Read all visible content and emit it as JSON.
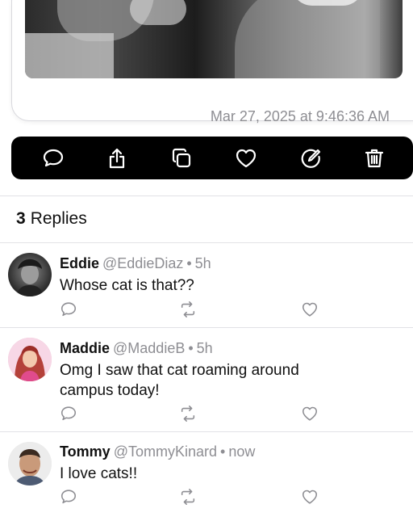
{
  "post": {
    "timestamp": "Mar 27, 2025 at 9:46:36 AM"
  },
  "actions": [
    {
      "name": "comment",
      "icon": "speech-bubble-icon"
    },
    {
      "name": "share",
      "icon": "share-icon"
    },
    {
      "name": "repost",
      "icon": "copy-icon"
    },
    {
      "name": "like",
      "icon": "heart-icon"
    },
    {
      "name": "edit",
      "icon": "edit-icon"
    },
    {
      "name": "delete",
      "icon": "trash-icon"
    }
  ],
  "replies_header": {
    "count": "3",
    "label": "Replies"
  },
  "replies": [
    {
      "name": "Eddie",
      "handle": "@EddieDiaz",
      "separator": "•",
      "time": "5h",
      "text": "Whose cat is that??"
    },
    {
      "name": "Maddie",
      "handle": "@MaddieB",
      "separator": "•",
      "time": "5h",
      "text": "Omg I saw that cat roaming around campus today!"
    },
    {
      "name": "Tommy",
      "handle": "@TommyKinard",
      "separator": "•",
      "time": "now",
      "text": "I love cats!!"
    }
  ],
  "colors": {
    "action_bar_bg": "#000000",
    "secondary_text": "#8e8e93",
    "divider": "#e2e2e6"
  }
}
